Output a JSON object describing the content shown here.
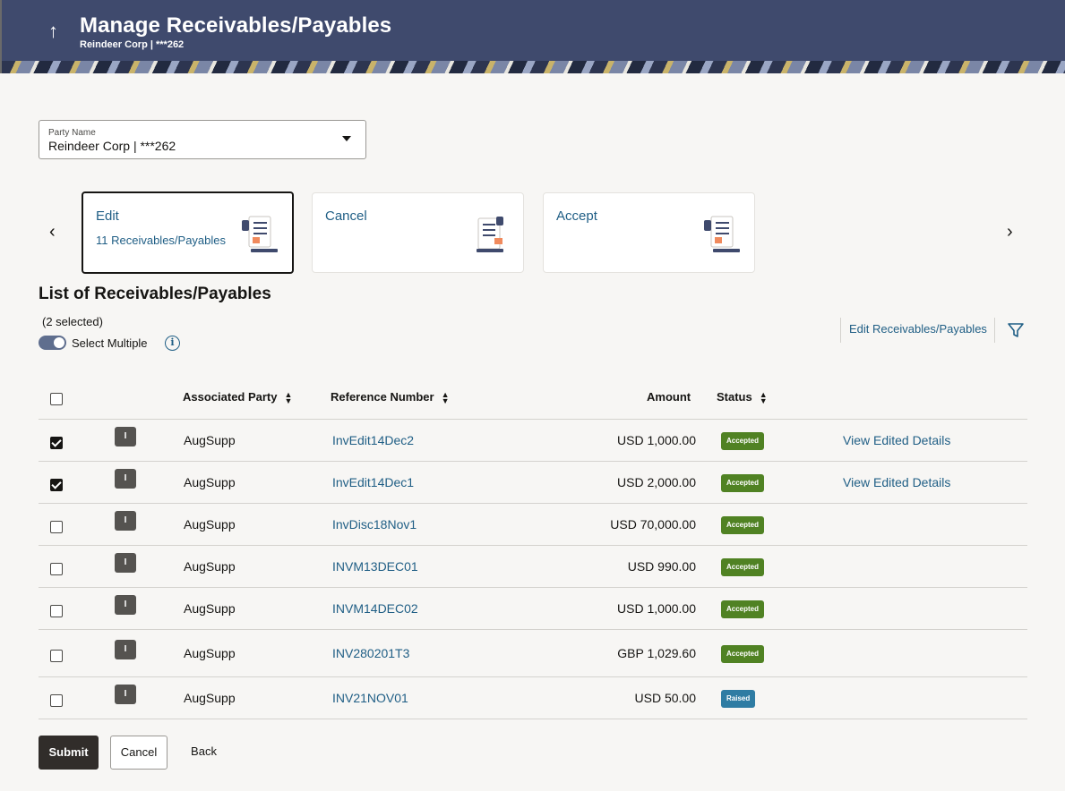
{
  "header": {
    "title": "Manage Receivables/Payables",
    "subtitle": "Reindeer Corp | ***262",
    "back_icon": "up-arrow-icon"
  },
  "party": {
    "label": "Party Name",
    "value": "Reindeer Corp | ***262"
  },
  "cards": [
    {
      "title": "Edit",
      "subtitle": "11 Receivables/Payables",
      "active": true
    },
    {
      "title": "Cancel",
      "subtitle": "",
      "active": false
    },
    {
      "title": "Accept",
      "subtitle": "",
      "active": false
    }
  ],
  "list": {
    "title": "List of Receivables/Payables",
    "selected_count": "(2 selected)",
    "select_multiple_label": "Select Multiple",
    "edit_link": "Edit Receivables/Payables",
    "columns": {
      "associated_party": "Associated Party",
      "reference_number": "Reference Number",
      "amount": "Amount",
      "status": "Status"
    },
    "rows": [
      {
        "checked": true,
        "party": "AugSupp",
        "ref": "InvEdit14Dec2",
        "amount": "USD 1,000.00",
        "status": "Accepted",
        "action": "View Edited Details"
      },
      {
        "checked": true,
        "party": "AugSupp",
        "ref": "InvEdit14Dec1",
        "amount": "USD 2,000.00",
        "status": "Accepted",
        "action": "View Edited Details"
      },
      {
        "checked": false,
        "party": "AugSupp",
        "ref": "InvDisc18Nov1",
        "amount": "USD 70,000.00",
        "status": "Accepted",
        "action": ""
      },
      {
        "checked": false,
        "party": "AugSupp",
        "ref": "INVM13DEC01",
        "amount": "USD 990.00",
        "status": "Accepted",
        "action": ""
      },
      {
        "checked": false,
        "party": "AugSupp",
        "ref": "INVM14DEC02",
        "amount": "USD 1,000.00",
        "status": "Accepted",
        "action": ""
      },
      {
        "checked": false,
        "party": "AugSupp",
        "ref": "INV280201T3",
        "amount": "GBP 1,029.60",
        "status": "Accepted",
        "action": ""
      },
      {
        "checked": false,
        "party": "AugSupp",
        "ref": "INV21NOV01",
        "amount": "USD 50.00",
        "status": "Raised",
        "action": ""
      }
    ]
  },
  "buttons": {
    "submit": "Submit",
    "cancel": "Cancel",
    "back": "Back"
  },
  "colors": {
    "header_bg": "#3f4a6d",
    "link": "#1f5e85",
    "accepted": "#508223",
    "raised": "#2f7ca3",
    "primary_button": "#312d2a"
  }
}
